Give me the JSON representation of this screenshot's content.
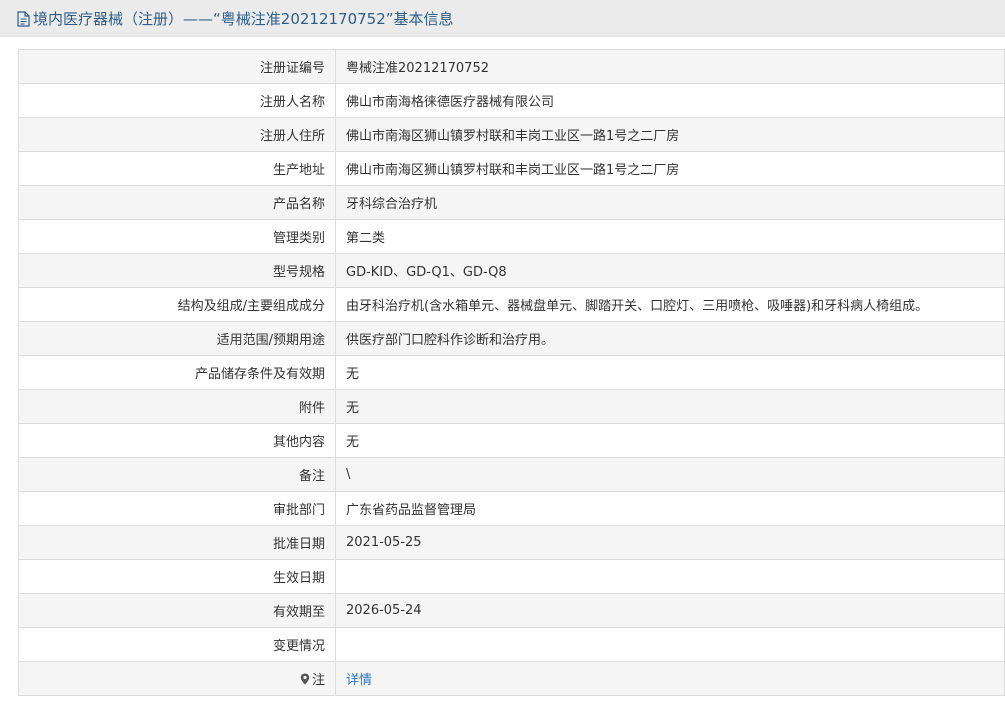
{
  "header": {
    "title": "境内医疗器械（注册）——“粤械注准20212170752”基本信息",
    "icon": "document-icon"
  },
  "rows": [
    {
      "label": "注册证编号",
      "value": "粤械注准20212170752"
    },
    {
      "label": "注册人名称",
      "value": "佛山市南海格徕德医疗器械有限公司"
    },
    {
      "label": "注册人住所",
      "value": "佛山市南海区狮山镇罗村联和丰岗工业区一路1号之二厂房"
    },
    {
      "label": "生产地址",
      "value": "佛山市南海区狮山镇罗村联和丰岗工业区一路1号之二厂房"
    },
    {
      "label": "产品名称",
      "value": "牙科综合治疗机"
    },
    {
      "label": "管理类别",
      "value": "第二类"
    },
    {
      "label": "型号规格",
      "value": "GD-KID、GD-Q1、GD-Q8"
    },
    {
      "label": "结构及组成/主要组成成分",
      "value": "由牙科治疗机(含水箱单元、器械盘单元、脚踏开关、口腔灯、三用喷枪、吸唾器)和牙科病人椅组成。"
    },
    {
      "label": "适用范围/预期用途",
      "value": "供医疗部门口腔科作诊断和治疗用。"
    },
    {
      "label": "产品储存条件及有效期",
      "value": "无"
    },
    {
      "label": "附件",
      "value": "无"
    },
    {
      "label": "其他内容",
      "value": "无"
    },
    {
      "label": "备注",
      "value": "\\"
    },
    {
      "label": "审批部门",
      "value": "广东省药品监督管理局"
    },
    {
      "label": "批准日期",
      "value": "2021-05-25"
    },
    {
      "label": "生效日期",
      "value": ""
    },
    {
      "label": "有效期至",
      "value": "2026-05-24"
    },
    {
      "label": "变更情况",
      "value": ""
    }
  ],
  "note": {
    "label": "注",
    "icon": "map-pin-icon",
    "link": "详情",
    "link_color": "#2d78c2"
  },
  "colors": {
    "title": "#2c5e8c",
    "header_bg": "#ebebeb",
    "border": "#dddddd",
    "alt_row_bg": "#f5f5f5"
  }
}
